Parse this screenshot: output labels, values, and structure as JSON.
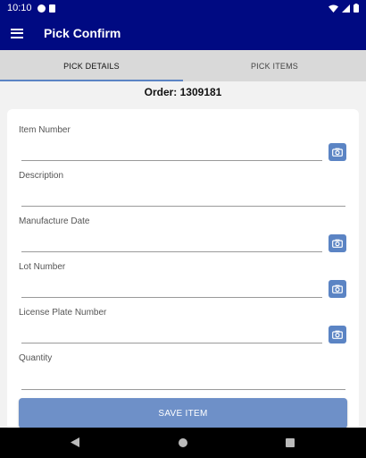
{
  "status_bar": {
    "time": "10:10"
  },
  "app_bar": {
    "title": "Pick Confirm"
  },
  "tabs": [
    {
      "label": "PICK DETAILS",
      "active": true
    },
    {
      "label": "PICK ITEMS",
      "active": false
    }
  ],
  "order": {
    "text": "Order: 1309181"
  },
  "fields": {
    "item_number": {
      "label": "Item Number",
      "value": "",
      "has_camera": true
    },
    "description": {
      "label": "Description",
      "value": "",
      "has_camera": false
    },
    "manufacture_date": {
      "label": "Manufacture Date",
      "value": "",
      "has_camera": true
    },
    "lot_number": {
      "label": "Lot Number",
      "value": "",
      "has_camera": true
    },
    "license_plate_number": {
      "label": "License Plate Number",
      "value": "",
      "has_camera": true
    },
    "quantity": {
      "label": "Quantity",
      "value": "",
      "has_camera": false
    }
  },
  "save_button": {
    "label": "SAVE ITEM"
  },
  "colors": {
    "app_bar": "#000a82",
    "accent": "#5b84c4",
    "save_button": "#6e90c8"
  }
}
